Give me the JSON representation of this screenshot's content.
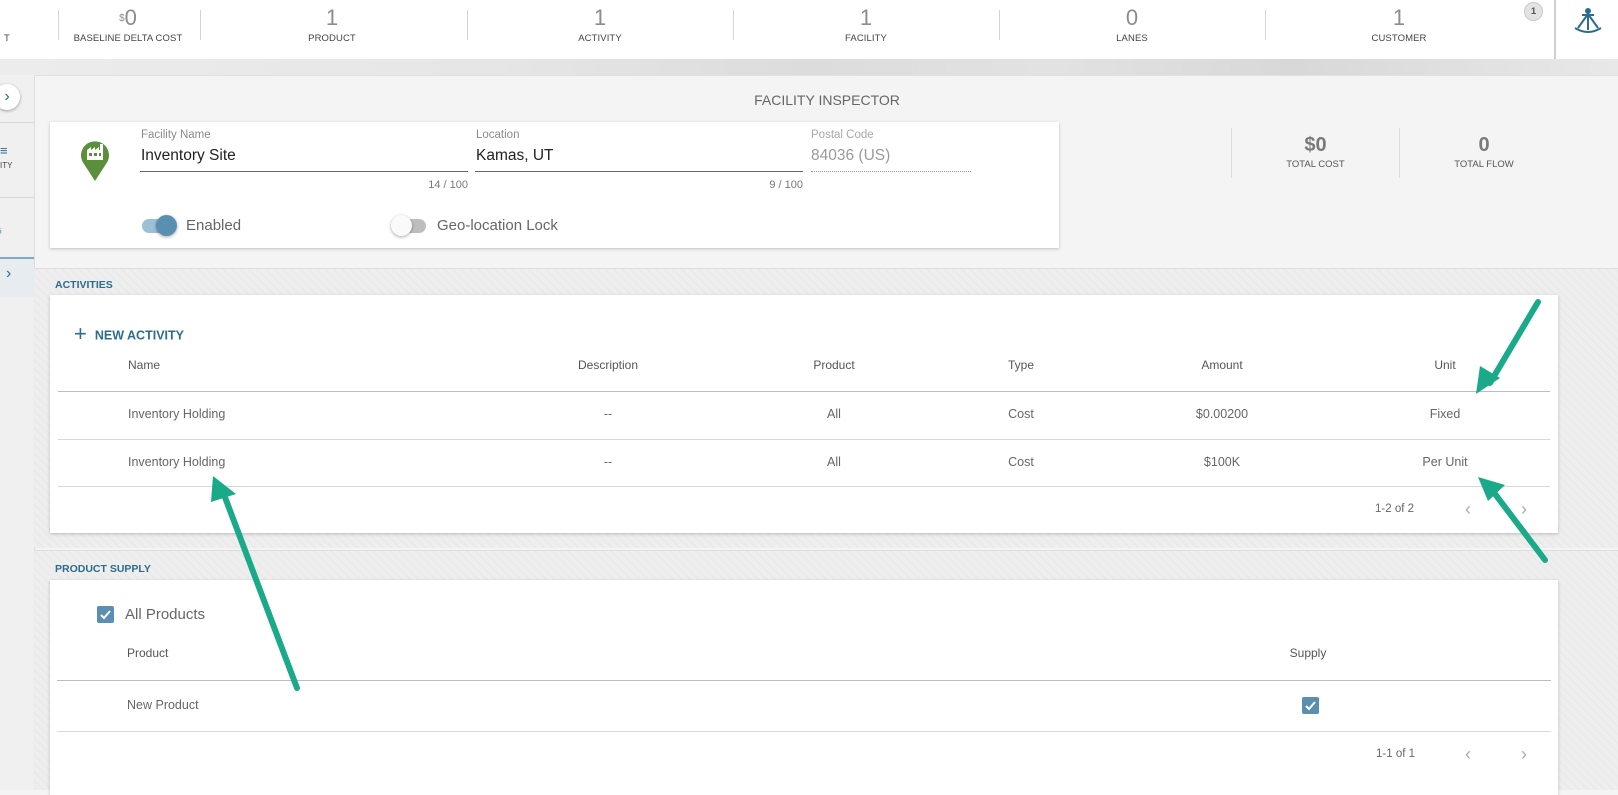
{
  "topbar": {
    "stats": [
      {
        "value": "",
        "label": "T"
      },
      {
        "currency": "$",
        "value": "0",
        "label": "BASELINE DELTA COST"
      },
      {
        "value": "1",
        "label": "PRODUCT"
      },
      {
        "value": "1",
        "label": "ACTIVITY"
      },
      {
        "value": "1",
        "label": "FACILITY"
      },
      {
        "value": "0",
        "label": "LANES"
      },
      {
        "value": "1",
        "label": "CUSTOMER"
      }
    ],
    "notification_count": "1",
    "logo_icon": "sextant-icon"
  },
  "leftrail": {
    "items": [
      {
        "label": "ITY"
      }
    ]
  },
  "inspector": {
    "title": "FACILITY INSPECTOR",
    "facility_icon": "factory-pin-icon",
    "facility_name": {
      "label": "Facility Name",
      "value": "Inventory Site",
      "count": "14 / 100"
    },
    "location": {
      "label": "Location",
      "value": "Kamas, UT",
      "count": "9 / 100"
    },
    "postal_code": {
      "label": "Postal Code",
      "value": "84036 (US)"
    },
    "enabled_label": "Enabled",
    "geolock_label": "Geo-location Lock",
    "total_cost": {
      "value": "$0",
      "label": "TOTAL COST"
    },
    "total_flow": {
      "value": "0",
      "label": "TOTAL FLOW"
    }
  },
  "activities": {
    "section_title": "ACTIVITIES",
    "new_label": "NEW ACTIVITY",
    "columns": [
      "Name",
      "Description",
      "Product",
      "Type",
      "Amount",
      "Unit"
    ],
    "rows": [
      {
        "name": "Inventory Holding",
        "description": "--",
        "product": "All",
        "type": "Cost",
        "amount": "$0.00200",
        "unit": "Fixed"
      },
      {
        "name": "Inventory Holding",
        "description": "--",
        "product": "All",
        "type": "Cost",
        "amount": "$100K",
        "unit": "Per Unit"
      }
    ],
    "pagination": "1-2 of 2"
  },
  "product_supply": {
    "section_title": "PRODUCT SUPPLY",
    "all_products_label": "All Products",
    "columns": [
      "Product",
      "Supply"
    ],
    "rows": [
      {
        "product": "New Product",
        "supply": true
      }
    ],
    "pagination": "1-1 of 1"
  },
  "colors": {
    "accent": "#2c6c8c",
    "annotation_arrow": "#1aaa8a",
    "facility_icon": "#5b8f3c"
  }
}
